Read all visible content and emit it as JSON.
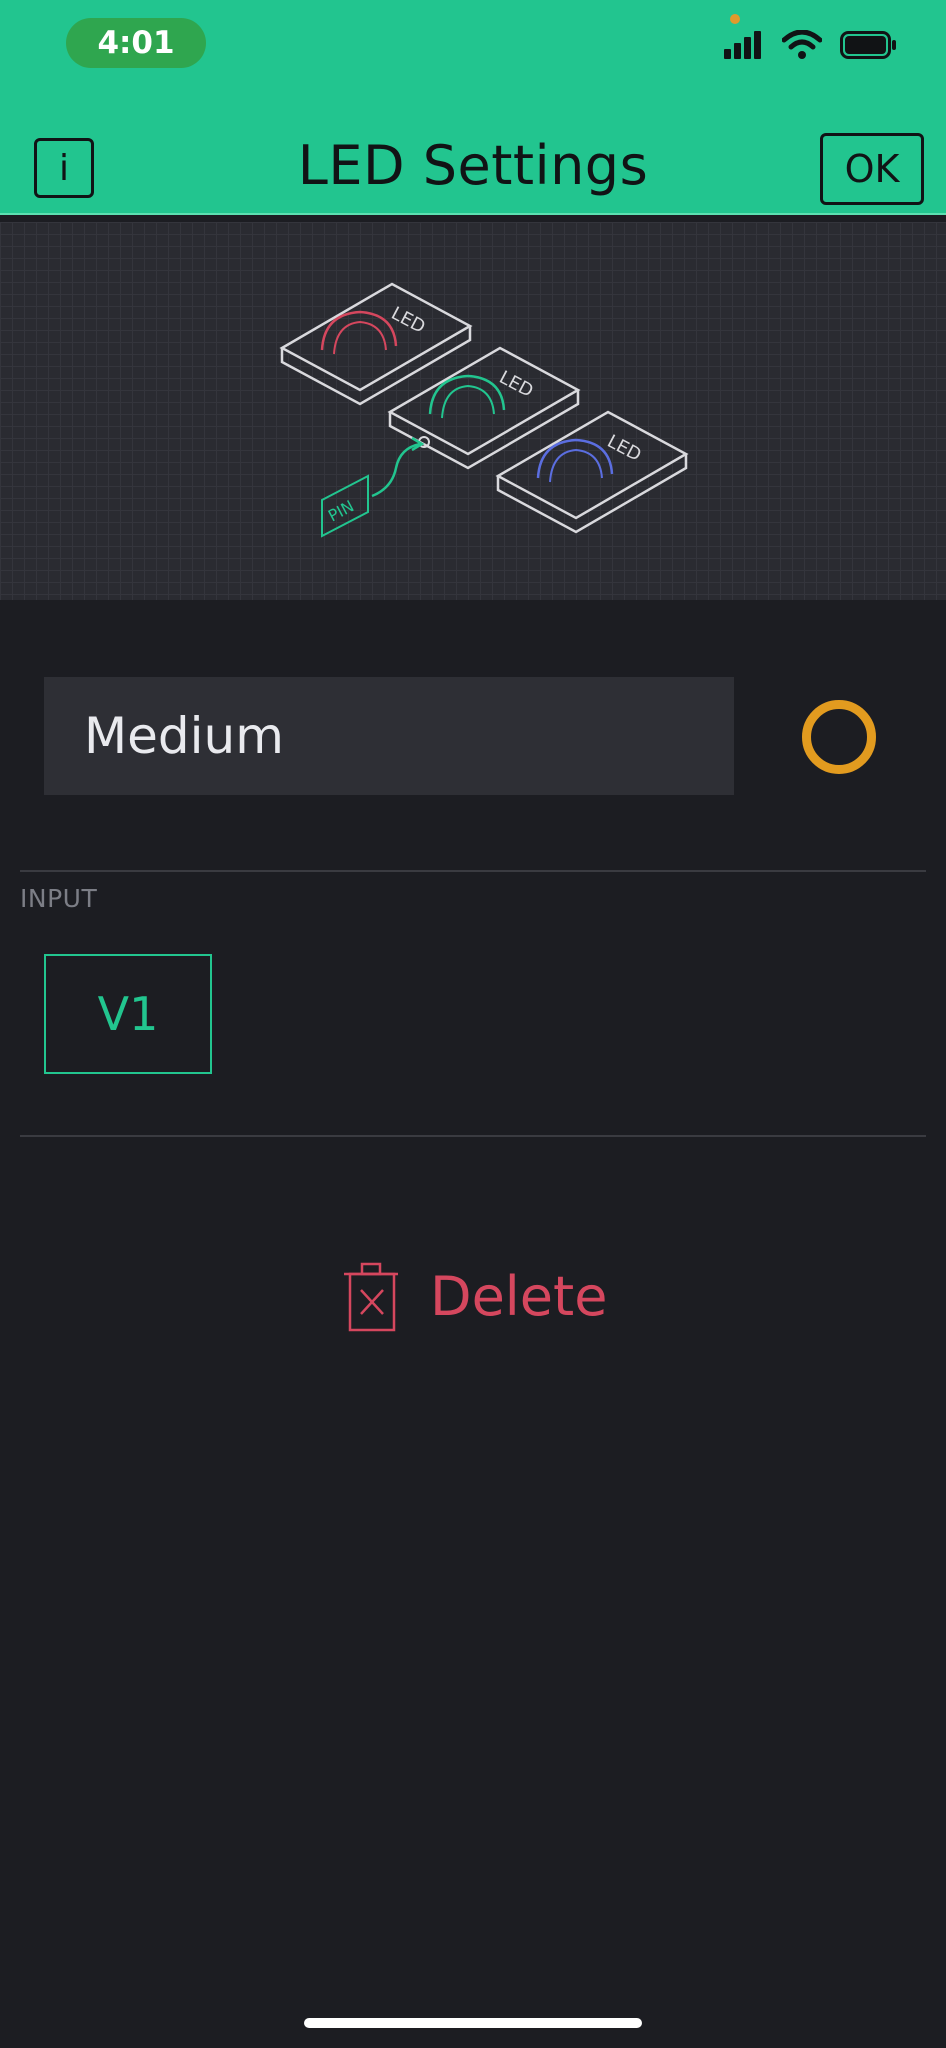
{
  "status_bar": {
    "time": "4:01"
  },
  "header": {
    "title": "LED Settings",
    "info_label": "i",
    "ok_label": "OK"
  },
  "illustration": {
    "led_label": "LED",
    "pin_label": "PIN",
    "colors": {
      "red": "#d5475e",
      "green": "#22c58f",
      "blue": "#5b6ee0",
      "outline": "#d9d9dd"
    }
  },
  "settings": {
    "name_value": "Medium",
    "color": "#e29b1f"
  },
  "input_section": {
    "label": "INPUT",
    "pin": "V1"
  },
  "delete": {
    "label": "Delete"
  }
}
